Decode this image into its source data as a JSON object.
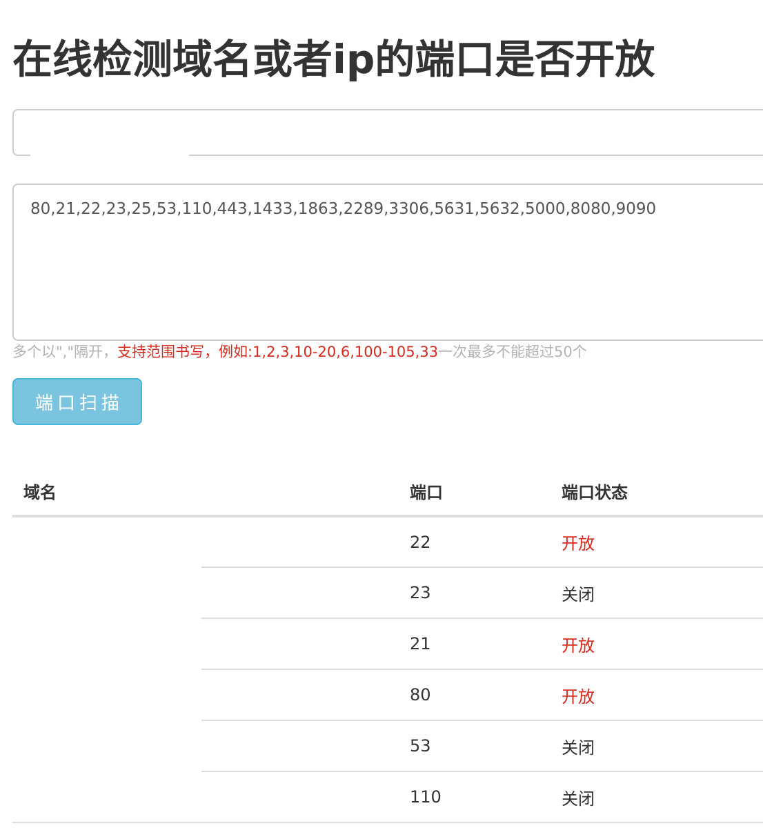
{
  "page": {
    "title": "在线检测域名或者ip的端口是否开放"
  },
  "form": {
    "host_value": "",
    "ports_value": "80,21,22,23,25,53,110,443,1433,1863,2289,3306,5631,5632,5000,8080,9090",
    "help_prefix": "多个以\",\"隔开，",
    "help_highlight": "支持范围书写，例如:1,2,3,10-20,6,100-105,33",
    "help_suffix": "一次最多不能超过50个",
    "scan_button_label": "端口扫描"
  },
  "table": {
    "headers": {
      "domain": "域名",
      "port": "端口",
      "status": "端口状态"
    },
    "domain_value": "",
    "rows": [
      {
        "port": "22",
        "status": "开放",
        "open": true
      },
      {
        "port": "23",
        "status": "关闭",
        "open": false
      },
      {
        "port": "21",
        "status": "开放",
        "open": true
      },
      {
        "port": "80",
        "status": "开放",
        "open": true
      },
      {
        "port": "53",
        "status": "关闭",
        "open": false
      },
      {
        "port": "110",
        "status": "关闭",
        "open": false
      }
    ]
  },
  "colors": {
    "open": "#d9291c",
    "closed": "#333333",
    "button_bg": "#7bc4df",
    "button_border": "#46b8da",
    "help_gray": "#b3b3b3"
  }
}
